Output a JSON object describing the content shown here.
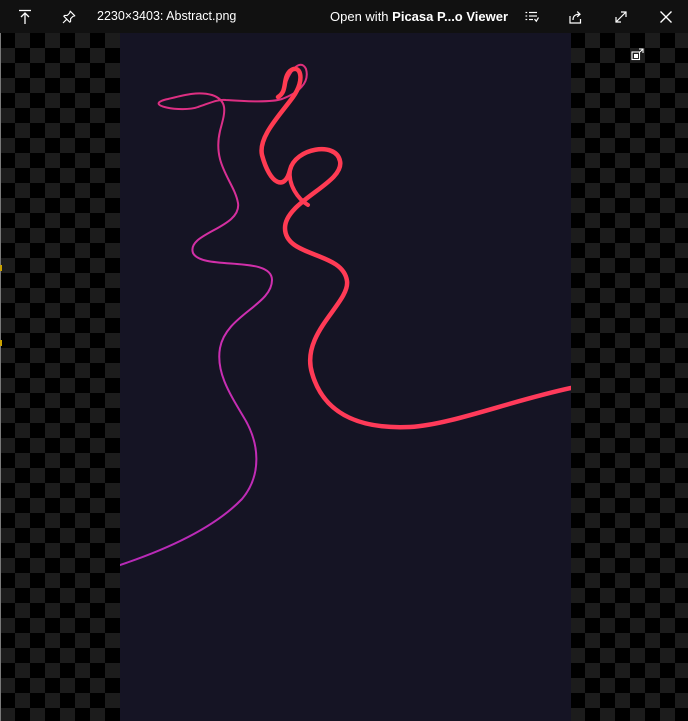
{
  "titlebar": {
    "filename": "2230×3403: Abstract.png",
    "open_with_prefix": "Open with ",
    "open_with_app": "Picasa P...o Viewer",
    "icons": {
      "back_to_top": "arrow-up-to-line-icon",
      "pin": "pin-icon",
      "list": "list-view-icon",
      "share": "share-icon",
      "fullscreen": "expand-icon",
      "close": "close-icon"
    }
  },
  "viewer": {
    "compact_overlay_icon": "compact-overlay-icon",
    "image_background": "#151424"
  },
  "colors": {
    "titlebar_bg": "#111111",
    "stroke_magenta": "#d4309d",
    "stroke_pink": "#e83a8a",
    "stroke_red": "#ff3b55",
    "stroke_coral": "#f03b63"
  }
}
